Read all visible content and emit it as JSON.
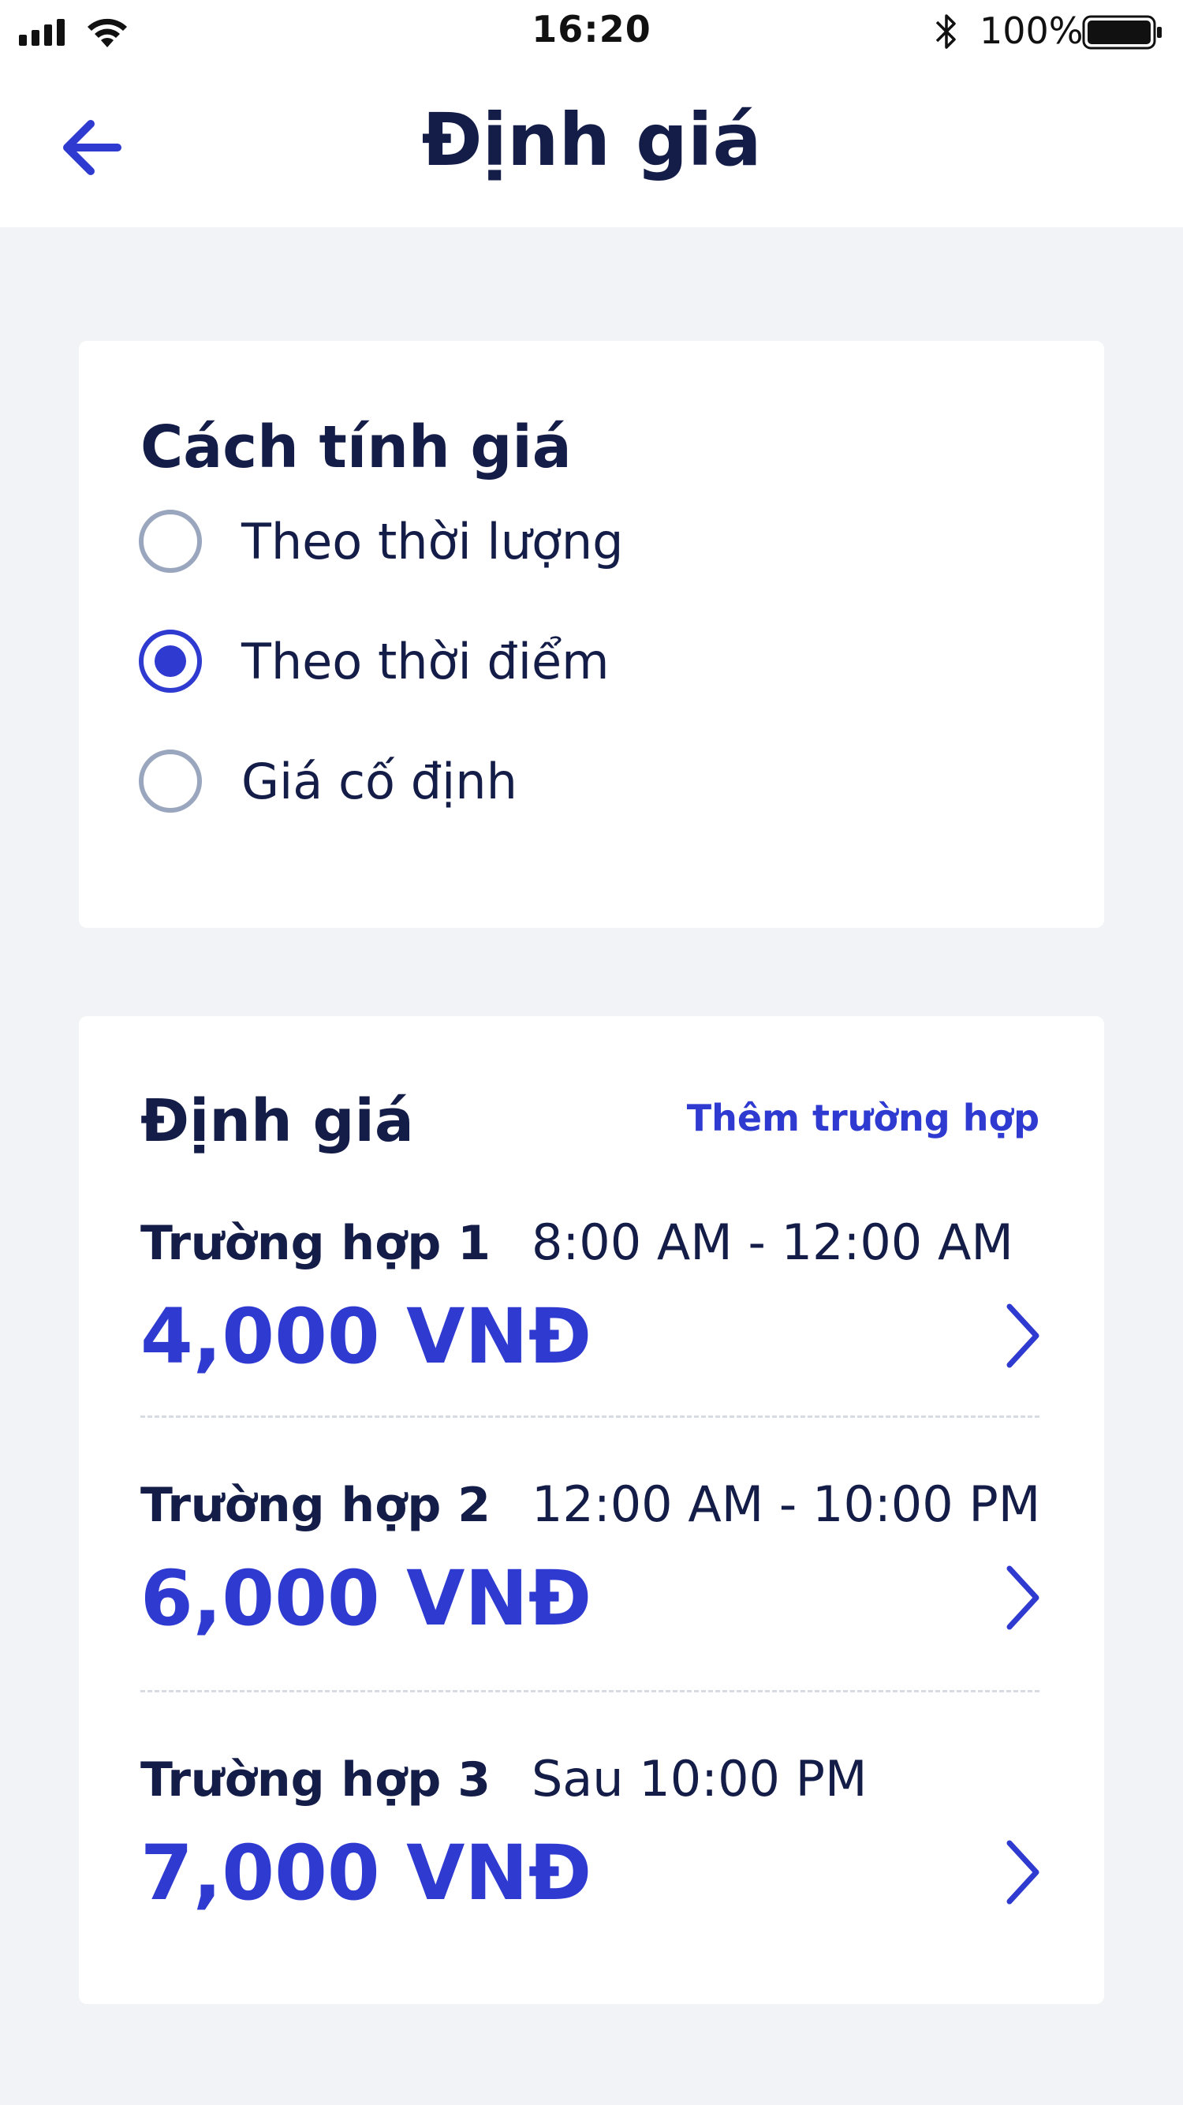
{
  "status_bar": {
    "time": "16:20",
    "battery": "100%"
  },
  "nav": {
    "title": "Định giá"
  },
  "pricing_method": {
    "title": "Cách tính giá",
    "options": [
      {
        "label": "Theo thời lượng",
        "selected": false
      },
      {
        "label": "Theo thời điểm",
        "selected": true
      },
      {
        "label": "Giá cố định",
        "selected": false
      }
    ]
  },
  "pricing": {
    "title": "Định giá",
    "add_label": "Thêm trường hợp",
    "cases": [
      {
        "name": "Trường hợp 1",
        "time": "8:00 AM - 12:00 AM",
        "price": "4,000 VNĐ"
      },
      {
        "name": "Trường hợp 2",
        "time": "12:00 AM - 10:00 PM",
        "price": "6,000 VNĐ"
      },
      {
        "name": "Trường hợp 3",
        "time": "Sau 10:00 PM",
        "price": "7,000 VNĐ"
      }
    ]
  },
  "colors": {
    "accent": "#2f3ad1",
    "text_dark": "#141c48",
    "background": "#f2f3f7",
    "radio_idle": "#9aa6bd"
  }
}
